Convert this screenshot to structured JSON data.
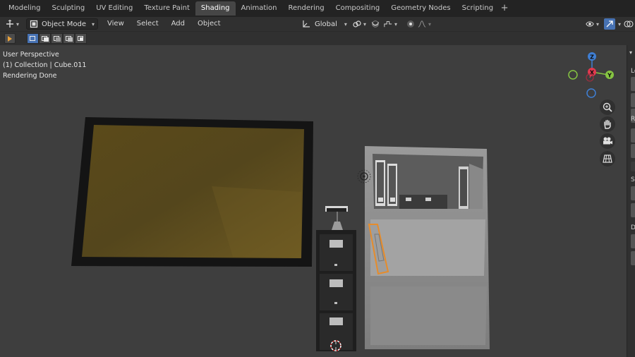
{
  "workspace_tabs": [
    {
      "label": "Modeling",
      "active": false
    },
    {
      "label": "Sculpting",
      "active": false
    },
    {
      "label": "UV Editing",
      "active": false
    },
    {
      "label": "Texture Paint",
      "active": false
    },
    {
      "label": "Shading",
      "active": true
    },
    {
      "label": "Animation",
      "active": false
    },
    {
      "label": "Rendering",
      "active": false
    },
    {
      "label": "Compositing",
      "active": false
    },
    {
      "label": "Geometry Nodes",
      "active": false
    },
    {
      "label": "Scripting",
      "active": false
    }
  ],
  "header": {
    "mode": "Object Mode",
    "menus": [
      "View",
      "Select",
      "Add",
      "Object"
    ],
    "transform_orientation": "Global"
  },
  "viewport": {
    "info": {
      "perspective": "User Perspective",
      "collection": "(1) Collection | Cube.011",
      "status": "Rendering Done"
    },
    "gizmo": {
      "x_label": "X",
      "y_label": "Y",
      "z_label": "Z",
      "x_color": "#e2394f",
      "y_color": "#86c442",
      "z_color": "#3f7fd4"
    },
    "nav_icons": [
      "zoom-icon",
      "hand-pan-icon",
      "camera-icon",
      "grid-icon"
    ]
  },
  "side_panel": {
    "labels": [
      "Lo",
      "R",
      "S",
      "D"
    ]
  },
  "colors": {
    "accent": "#4772b3",
    "active_tool": "#e9a23b",
    "selection_outline": "#e68c2b",
    "viewport_bg": "#3e3e3e",
    "board_fill": "#5a4c1c"
  }
}
